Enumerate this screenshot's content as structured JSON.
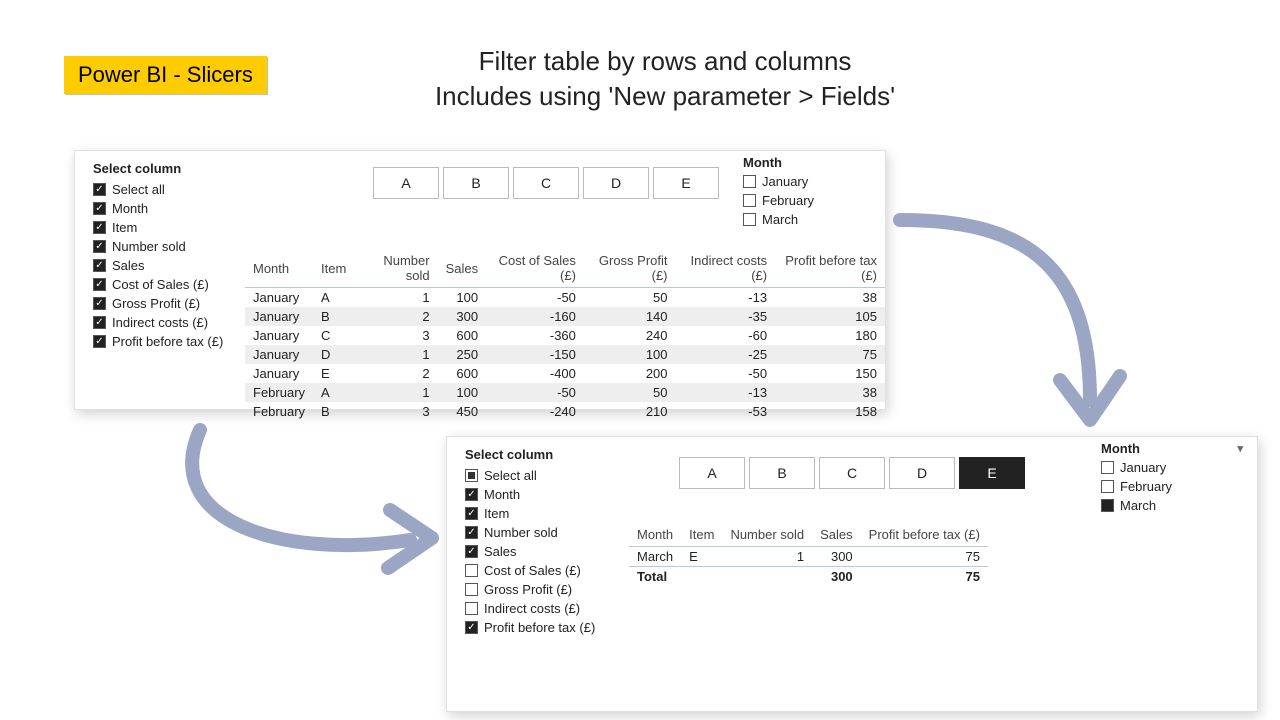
{
  "badge": "Power BI - Slicers",
  "title_line1": "Filter table by rows and columns",
  "title_line2": "Includes using 'New parameter > Fields'",
  "slicer_col_label": "Select column",
  "columns": [
    "Select all",
    "Month",
    "Item",
    "Number sold",
    "Sales",
    "Cost of Sales (£)",
    "Gross Profit (£)",
    "Indirect costs (£)",
    "Profit before tax (£)"
  ],
  "panel_a": {
    "col_checked": [
      true,
      true,
      true,
      true,
      true,
      true,
      true,
      true,
      true
    ],
    "items": [
      "A",
      "B",
      "C",
      "D",
      "E"
    ],
    "item_selected": null,
    "month_label": "Month",
    "months": [
      {
        "label": "January",
        "checked": false
      },
      {
        "label": "February",
        "checked": false
      },
      {
        "label": "March",
        "checked": false
      }
    ],
    "headers": [
      "Month",
      "Item",
      "Number sold",
      "Sales",
      "Cost of Sales (£)",
      "Gross Profit (£)",
      "Indirect costs (£)",
      "Profit before tax (£)"
    ],
    "rows": [
      [
        "January",
        "A",
        "1",
        "100",
        "-50",
        "50",
        "-13",
        "38"
      ],
      [
        "January",
        "B",
        "2",
        "300",
        "-160",
        "140",
        "-35",
        "105"
      ],
      [
        "January",
        "C",
        "3",
        "600",
        "-360",
        "240",
        "-60",
        "180"
      ],
      [
        "January",
        "D",
        "1",
        "250",
        "-150",
        "100",
        "-25",
        "75"
      ],
      [
        "January",
        "E",
        "2",
        "600",
        "-400",
        "200",
        "-50",
        "150"
      ],
      [
        "February",
        "A",
        "1",
        "100",
        "-50",
        "50",
        "-13",
        "38"
      ],
      [
        "February",
        "B",
        "3",
        "450",
        "-240",
        "210",
        "-53",
        "158"
      ]
    ]
  },
  "panel_b": {
    "col_state": [
      "mixed",
      "checked",
      "checked",
      "checked",
      "checked",
      "",
      "",
      "",
      "checked"
    ],
    "items": [
      "A",
      "B",
      "C",
      "D",
      "E"
    ],
    "item_selected": "E",
    "month_label": "Month",
    "months": [
      {
        "label": "January",
        "checked": false
      },
      {
        "label": "February",
        "checked": false
      },
      {
        "label": "March",
        "checked": true
      }
    ],
    "headers": [
      "Month",
      "Item",
      "Number sold",
      "Sales",
      "Profit before tax (£)"
    ],
    "rows": [
      [
        "March",
        "E",
        "1",
        "300",
        "75"
      ]
    ],
    "total_label": "Total",
    "total": [
      "",
      "",
      "",
      "300",
      "75"
    ]
  }
}
